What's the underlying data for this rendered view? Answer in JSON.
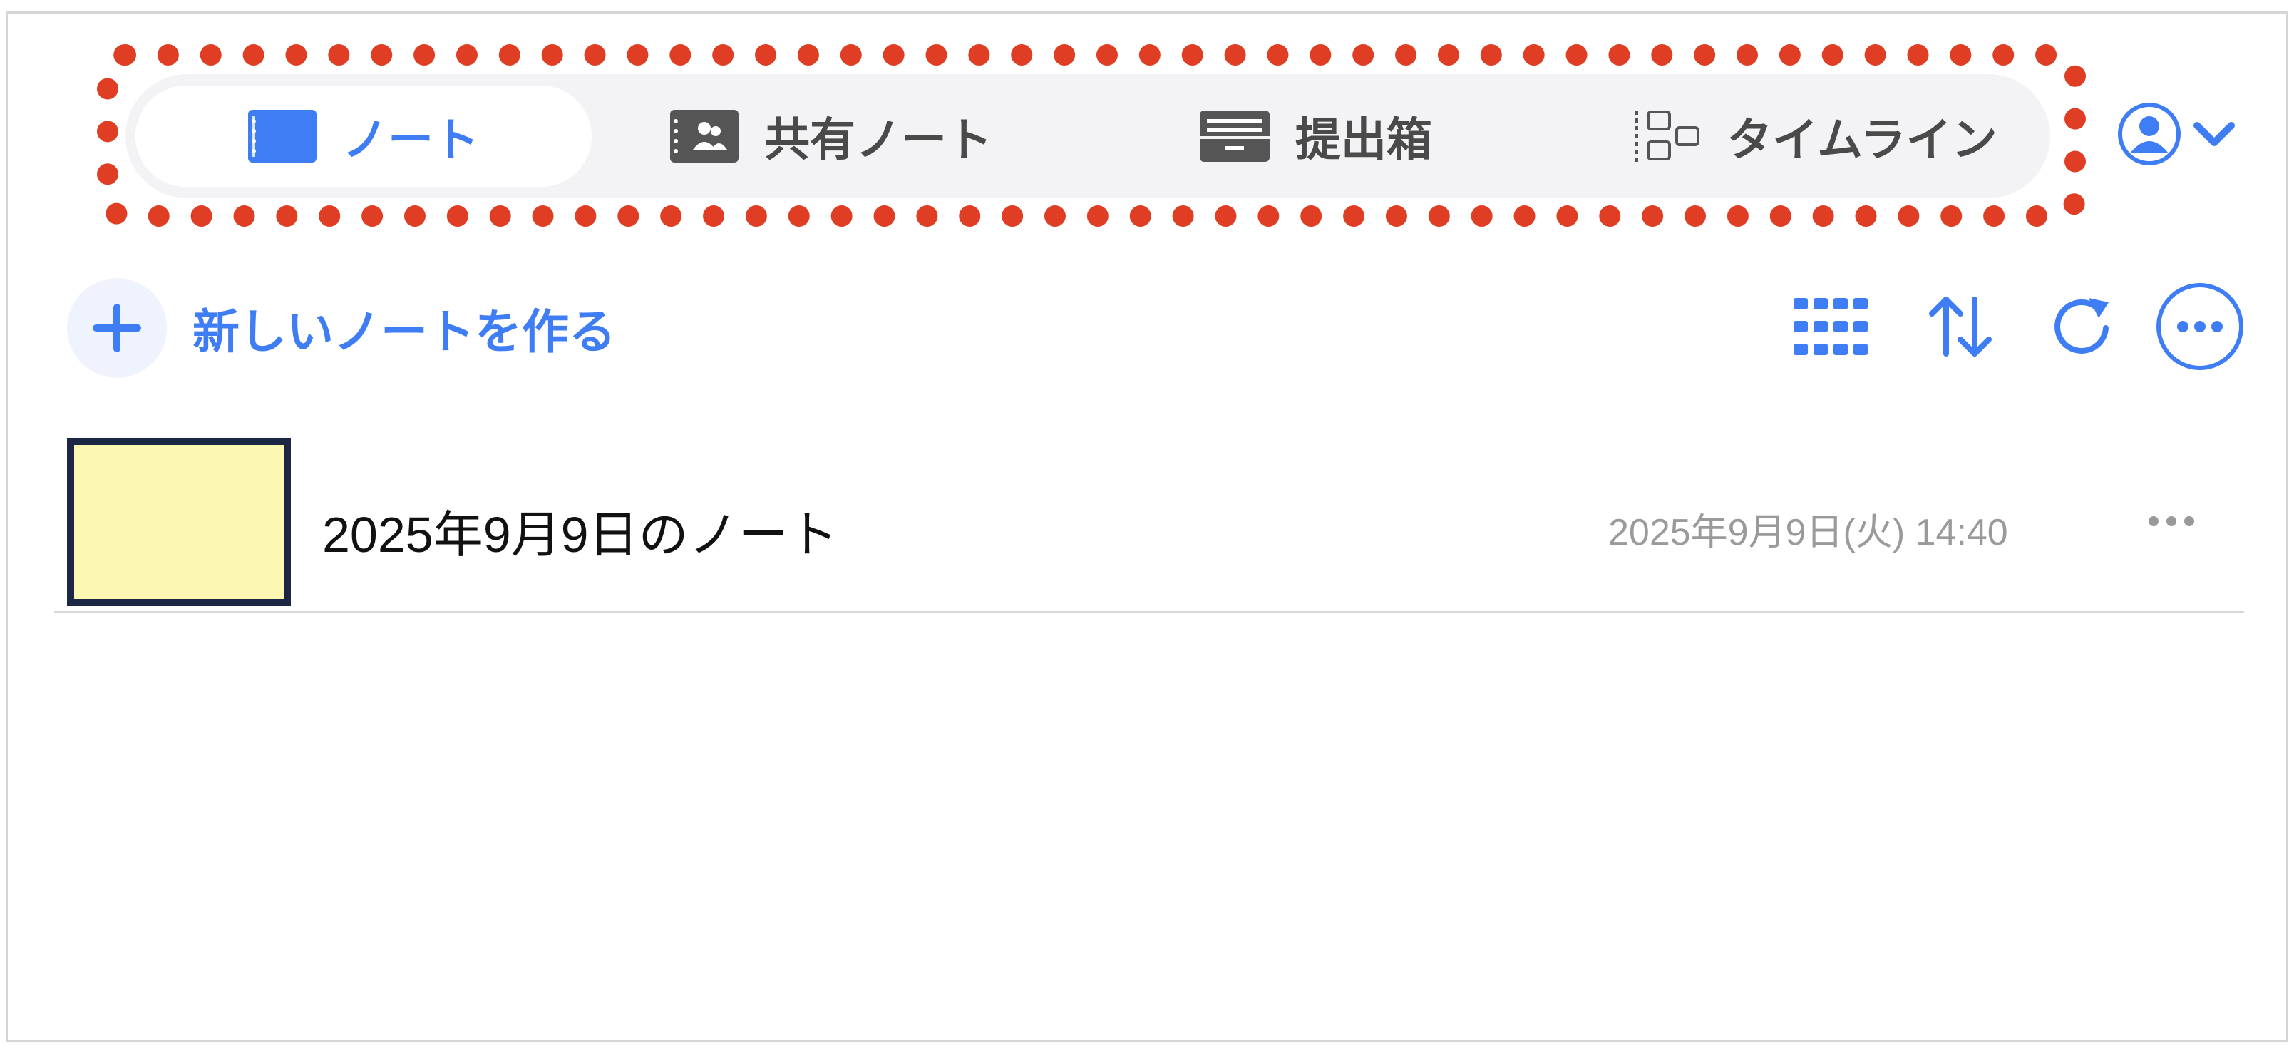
{
  "tabs": [
    {
      "label": "ノート",
      "icon": "notebook-icon",
      "active": true
    },
    {
      "label": "共有ノート",
      "icon": "shared-note-icon",
      "active": false
    },
    {
      "label": "提出箱",
      "icon": "submission-box-icon",
      "active": false
    },
    {
      "label": "タイムライン",
      "icon": "timeline-icon",
      "active": false
    }
  ],
  "profile": {
    "icon": "user-avatar-icon",
    "menu_icon": "chevron-down-icon"
  },
  "toolbar": {
    "new_note_label": "新しいノートを作る",
    "new_note_icon": "plus-icon",
    "grid_icon": "grid-view-icon",
    "sort_icon": "sort-icon",
    "refresh_icon": "refresh-icon",
    "more_icon": "more-options-icon"
  },
  "notes": [
    {
      "title": "2025年9月9日のノート",
      "date": "2025年9月9日(火) 14:40",
      "thumb_color": "#fcf8b4"
    }
  ],
  "colors": {
    "accent": "#3f7df5",
    "highlight": "#df3e24",
    "tab_bg": "#f3f3f5"
  }
}
